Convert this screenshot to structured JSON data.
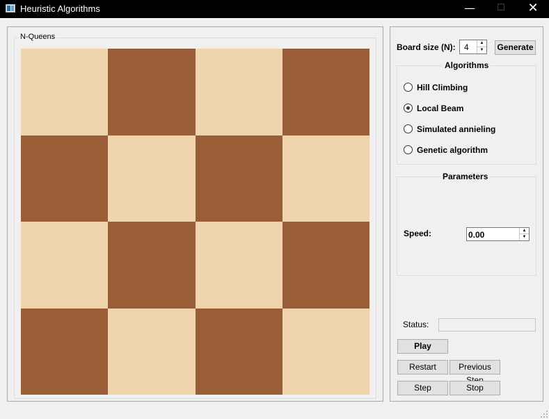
{
  "window": {
    "title": "Heuristic Algorithms",
    "minimize_glyph": "—",
    "maximize_glyph": "☐",
    "close_glyph": "✕",
    "app_icon": "app-window-icon"
  },
  "board_panel": {
    "group_title": "N-Queens",
    "board": {
      "size": 4,
      "light_color": "#efd5ae",
      "dark_color": "#995d37",
      "top_left": "light",
      "queens": []
    }
  },
  "controls": {
    "board_size_label": "Board size (N):",
    "board_size_value": "4",
    "generate_label": "Generate",
    "algorithms_title": "Algorithms",
    "algorithms": [
      {
        "label": "Hill Climbing",
        "checked": false
      },
      {
        "label": "Local Beam",
        "checked": true
      },
      {
        "label": "Simulated annieling",
        "checked": false
      },
      {
        "label": "Genetic algorithm",
        "checked": false
      }
    ],
    "parameters_title": "Parameters",
    "speed_label": "Speed:",
    "speed_value": "0.00",
    "status_label": "Status:",
    "status_value": "",
    "play_label": "Play",
    "restart_label": "Restart",
    "previous_step_label": "Previous Step",
    "step_label": "Step",
    "stop_label": "Stop"
  }
}
